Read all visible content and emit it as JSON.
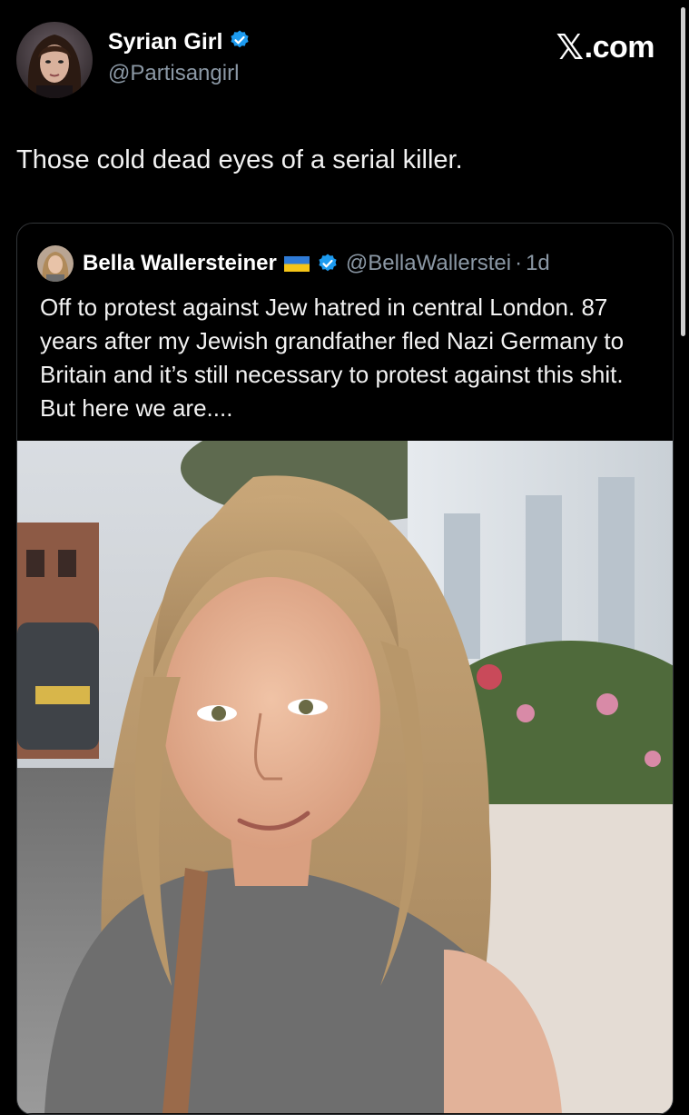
{
  "author": {
    "display_name": "Syrian Girl",
    "handle": "@Partisangirl",
    "verified_icon": "verified-badge-icon"
  },
  "brand": {
    "x_glyph": "𝕏",
    "suffix": ".com"
  },
  "tweet": {
    "text": "Those cold dead eyes of a serial killer."
  },
  "quoted_tweet": {
    "display_name": "Bella Wallersteiner",
    "flag_icon": "ukraine-flag-icon",
    "verified_icon": "verified-badge-icon",
    "handle": "@BellaWallerstei",
    "separator": "·",
    "time": "1d",
    "text": "Off to protest against Jew hatred in central London. 87 years after my Jewish grandfather fled Nazi Germany to Britain and it’s still necessary to protest against this shit. But here we are....",
    "media_icon": "photo-selfie"
  },
  "colors": {
    "background": "#000000",
    "verified_blue": "#1d9bf0",
    "secondary_text": "#8b98a5",
    "card_border": "#333639"
  }
}
